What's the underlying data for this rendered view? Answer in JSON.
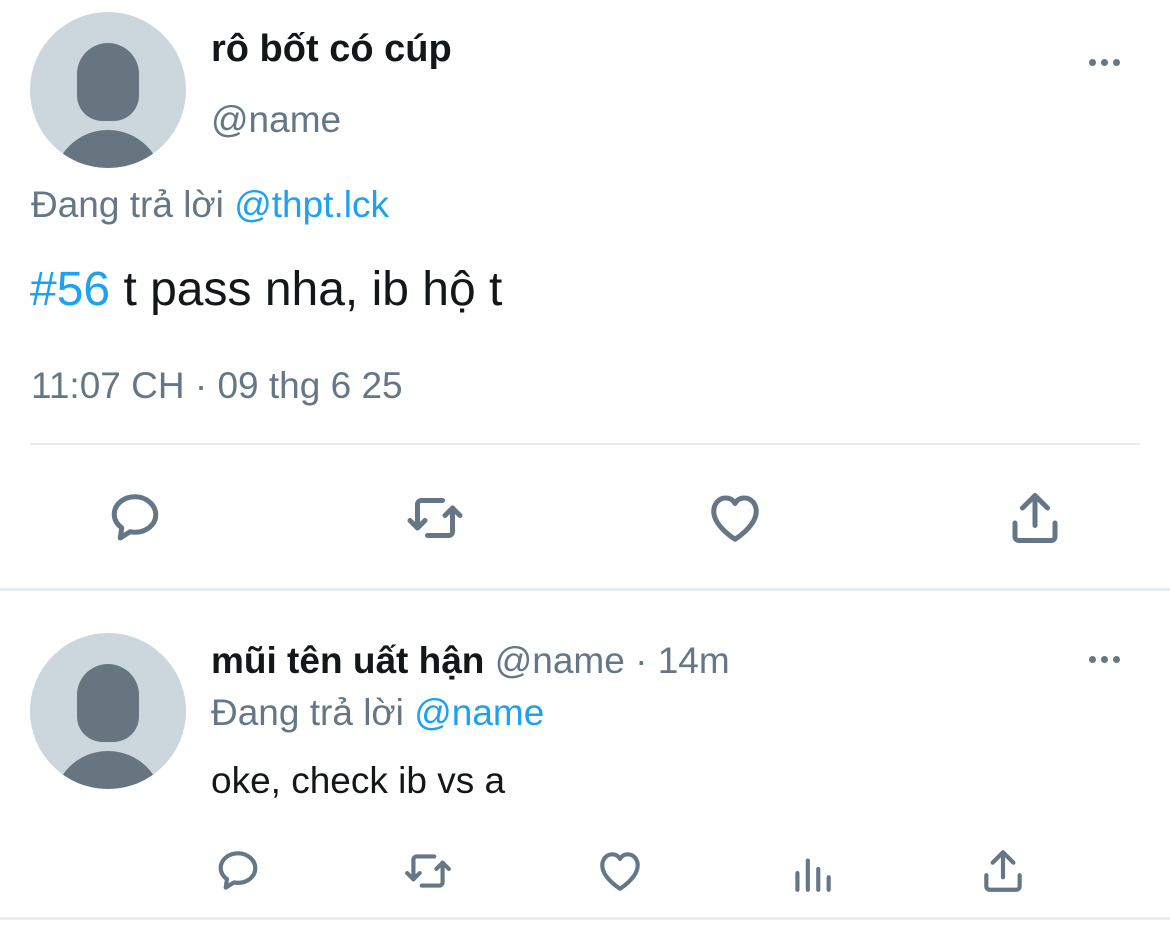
{
  "main_tweet": {
    "author_name": "rô bốt có cúp",
    "author_handle": "@name",
    "replying_prefix": "Đang trả lời",
    "replying_to": "@thpt.lck",
    "hashtag": "#56",
    "text": "t pass nha, ib hộ t",
    "time": "11:07 CH",
    "separator": "·",
    "date": "09 thg 6 25",
    "actions": [
      "reply-icon",
      "retweet-icon",
      "like-icon",
      "share-icon"
    ],
    "more_icon": "more-icon"
  },
  "reply_tweet": {
    "author_name": "mũi tên uất hận",
    "author_handle": "@name",
    "separator": "·",
    "relative_time": "14m",
    "replying_prefix": "Đang trả lời",
    "replying_to": "@name",
    "text": "oke, check ib vs a",
    "actions": [
      "reply-icon",
      "retweet-icon",
      "like-icon",
      "analytics-icon",
      "share-icon"
    ],
    "more_icon": "more-icon"
  },
  "colors": {
    "link": "#1da1f2",
    "secondary_text": "#657786",
    "primary_text": "#14171a",
    "avatar_bg": "#ccd6dd",
    "avatar_fg": "#66757f",
    "divider": "#e6ecf0"
  }
}
